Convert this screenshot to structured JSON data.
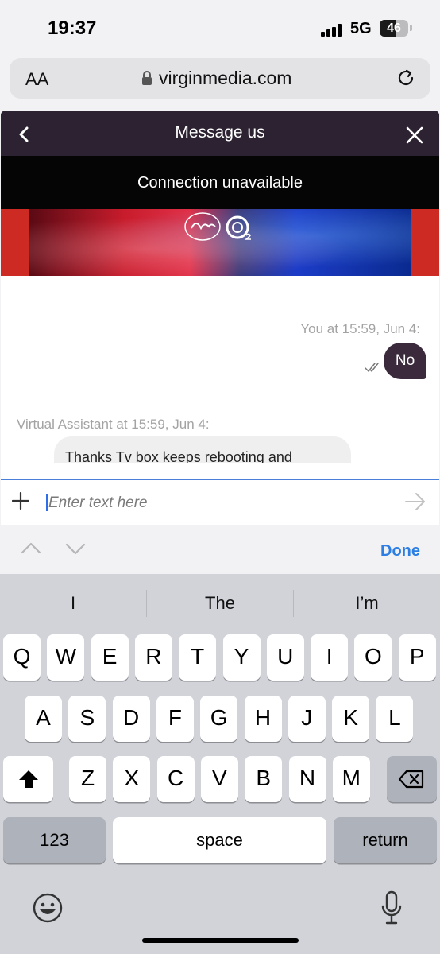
{
  "status": {
    "time": "19:37",
    "network": "5G",
    "battery": "46"
  },
  "browser": {
    "aa_label": "AA",
    "url": "virginmedia.com"
  },
  "chat": {
    "title": "Message us",
    "banner_text": "Connection unavailable",
    "messages": [
      {
        "meta": "You at 15:59, Jun 4:",
        "text": "No"
      },
      {
        "meta": "Virtual Assistant at 15:59, Jun 4:",
        "text": "Thanks Tv box keeps rebooting and"
      }
    ],
    "input": {
      "placeholder": "Enter text here"
    }
  },
  "accessory": {
    "done_label": "Done"
  },
  "keyboard": {
    "suggestions": [
      "I",
      "The",
      "I’m"
    ],
    "row1": [
      "Q",
      "W",
      "E",
      "R",
      "T",
      "Y",
      "U",
      "I",
      "O",
      "P"
    ],
    "row2": [
      "A",
      "S",
      "D",
      "F",
      "G",
      "H",
      "J",
      "K",
      "L"
    ],
    "row3": [
      "Z",
      "X",
      "C",
      "V",
      "B",
      "N",
      "M"
    ],
    "numbers_label": "123",
    "space_label": "space",
    "return_label": "return"
  }
}
